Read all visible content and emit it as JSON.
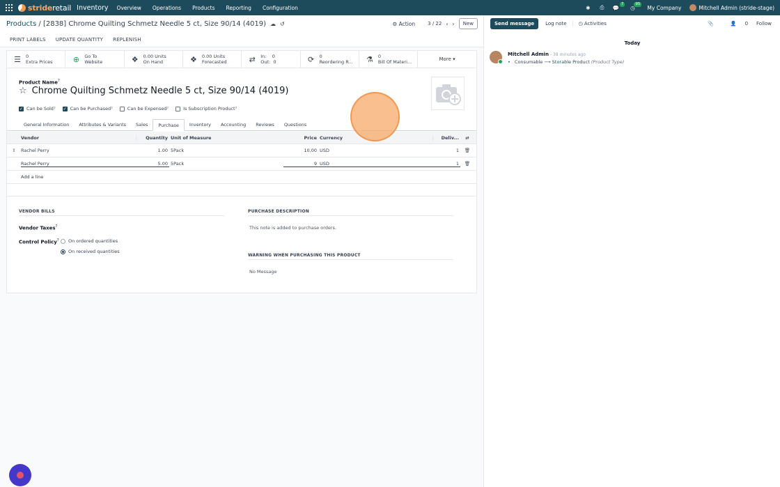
{
  "nav": {
    "brand_a": "stride",
    "brand_b": "retail",
    "app": "Inventory",
    "menus": [
      "Overview",
      "Operations",
      "Products",
      "Reporting",
      "Configuration"
    ],
    "chat_badge": "7",
    "activity_badge": "95",
    "company": "My Company",
    "user": "Mitchell Admin (stride-stage)"
  },
  "control": {
    "breadcrumb_parent": "Products",
    "breadcrumb_current": "[2838] Chrome Quilting Schmetz Needle 5 ct, Size 90/14 (4019)",
    "action": "Action",
    "pager": "3 / 22",
    "new": "New"
  },
  "toolbar": [
    "PRINT LABELS",
    "UPDATE QUANTITY",
    "REPLENISH"
  ],
  "stats": [
    {
      "icon": "list-icon",
      "glyph": "☰",
      "l1": "0",
      "l2": "Extra Prices"
    },
    {
      "icon": "globe-icon",
      "glyph": "⊕",
      "l1": "Go To",
      "l2": "Website"
    },
    {
      "icon": "cubes-icon",
      "glyph": "❖",
      "l1": "0.00 Units",
      "l2": "On Hand"
    },
    {
      "icon": "cubes-icon",
      "glyph": "❖",
      "l1": "0.00 Units",
      "l2": "Forecasted"
    },
    {
      "icon": "exchange-icon",
      "glyph": "⇄",
      "l1": "In:    0",
      "l2": "Out:  0"
    },
    {
      "icon": "refresh-icon",
      "glyph": "⟳",
      "l1": "0",
      "l2": "Reordering R..."
    },
    {
      "icon": "flask-icon",
      "glyph": "⚗",
      "l1": "0",
      "l2": "Bill Of Materi..."
    }
  ],
  "more": "More ▾",
  "product": {
    "name_label": "Product Name",
    "name": "Chrome Quilting Schmetz Needle 5 ct, Size 90/14 (4019)",
    "checks": [
      {
        "label": "Can be Sold",
        "on": true,
        "help": "?"
      },
      {
        "label": "Can be Purchased",
        "on": true,
        "help": "?"
      },
      {
        "label": "Can be Expensed",
        "on": false,
        "help": "?"
      },
      {
        "label": "Is Subscription Product",
        "on": false,
        "help": "?"
      }
    ]
  },
  "tabs": [
    "General Information",
    "Attributes & Variants",
    "Sales",
    "Purchase",
    "Inventory",
    "Accounting",
    "Reviews",
    "Questions"
  ],
  "active_tab": "Purchase",
  "table": {
    "headers": {
      "vendor": "Vendor",
      "qty": "Quantity",
      "uom": "Unit of Measure",
      "price": "Price",
      "currency": "Currency",
      "deliv": "Deliv..."
    },
    "rows": [
      {
        "vendor": "Rachel Perry",
        "qty": "1.00",
        "uom": "5Pack",
        "price": "10.00",
        "currency": "USD",
        "deliv": "1"
      },
      {
        "vendor": "Rachel Perry",
        "qty": "5.00",
        "uom": "5Pack",
        "price": "9",
        "currency": "USD",
        "deliv": "1"
      }
    ],
    "add_line": "Add a line"
  },
  "vendor_bills": {
    "title": "VENDOR BILLS",
    "taxes_label": "Vendor Taxes",
    "policy_label": "Control Policy",
    "options": [
      "On ordered quantities",
      "On received quantities"
    ],
    "selected": 1
  },
  "purchase_desc": {
    "title": "PURCHASE DESCRIPTION",
    "placeholder": "This note is added to purchase orders."
  },
  "warning": {
    "title": "WARNING WHEN PURCHASING THIS PRODUCT",
    "value": "No Message"
  },
  "chatter": {
    "send": "Send message",
    "log": "Log note",
    "activities": "Activities",
    "followers": "0",
    "follow": "Follow",
    "today": "Today",
    "message": {
      "author": "Mitchell Admin",
      "time": "- 38 minutes ago",
      "old": "Consumable",
      "new": "Storable Product",
      "field": "(Product Type)"
    }
  },
  "colors": {
    "brand": "#1e4b5b",
    "accent": "#f6a561"
  }
}
